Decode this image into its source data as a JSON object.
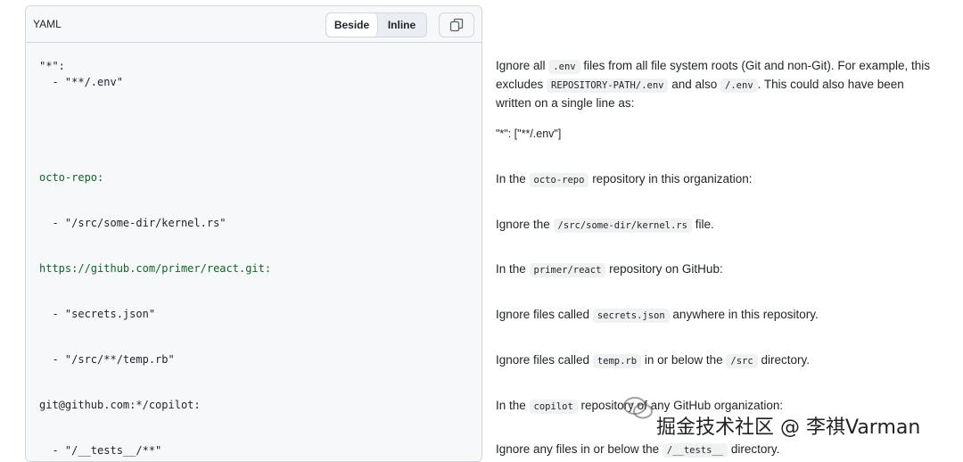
{
  "header": {
    "language": "YAML",
    "view_beside": "Beside",
    "view_inline": "Inline",
    "active_view": "Beside"
  },
  "code_lines": [
    {
      "text": "\"*\":",
      "kind": "plain"
    },
    {
      "text": "  - \"**/.env\"",
      "kind": "plain"
    },
    {
      "text": "octo-repo:",
      "kind": "key"
    },
    {
      "text": "  - \"/src/some-dir/kernel.rs\"",
      "kind": "plain"
    },
    {
      "text": "https://github.com/primer/react.git:",
      "kind": "key"
    },
    {
      "text": "  - \"secrets.json\"",
      "kind": "plain"
    },
    {
      "text": "  - \"/src/**/temp.rb\"",
      "kind": "plain"
    },
    {
      "text": "git@github.com:*/copilot:",
      "kind": "plain"
    },
    {
      "text": "  - \"/__tests__/**\"",
      "kind": "plain"
    }
  ],
  "descriptions": {
    "d1": {
      "p1": "Ignore all ",
      "c1": ".env",
      "p2": " files from all file system roots (Git and non-Git). For example, this excludes ",
      "c2": "REPOSITORY-PATH/.env",
      "p3": " and also ",
      "c3": "/.env",
      "p4": ". This could also have been written on a single line as:"
    },
    "d1b": "\"*\": [\"**/.env\"]",
    "d2": {
      "p1": "In the ",
      "c1": "octo-repo",
      "p2": " repository in this organization:"
    },
    "d3": {
      "p1": "Ignore the ",
      "c1": "/src/some-dir/kernel.rs",
      "p2": " file."
    },
    "d4": {
      "p1": "In the ",
      "c1": "primer/react",
      "p2": " repository on GitHub:"
    },
    "d5": {
      "p1": "Ignore files called ",
      "c1": "secrets.json",
      "p2": " anywhere in this repository."
    },
    "d6": {
      "p1": "Ignore files called ",
      "c1": "temp.rb",
      "p2": " in or below the ",
      "c2": "/src",
      "p3": " directory."
    },
    "d7": {
      "p1": "In the ",
      "c1": "copilot",
      "p2": " repository of any GitHub organization:"
    },
    "d8": {
      "p1": "Ignore any files in or below the ",
      "c1": "/__tests__",
      "p2": " directory."
    }
  },
  "watermark": {
    "text": "掘金技术社区 @ 李祺Varman"
  },
  "icons": {
    "copy": "copy-icon",
    "watermark_logo": "wechat-icon"
  },
  "colors": {
    "key": "#116329",
    "border": "#d0d7de",
    "panel_bg": "#f6f8fa",
    "inline_code_bg": "#eff1f3"
  }
}
